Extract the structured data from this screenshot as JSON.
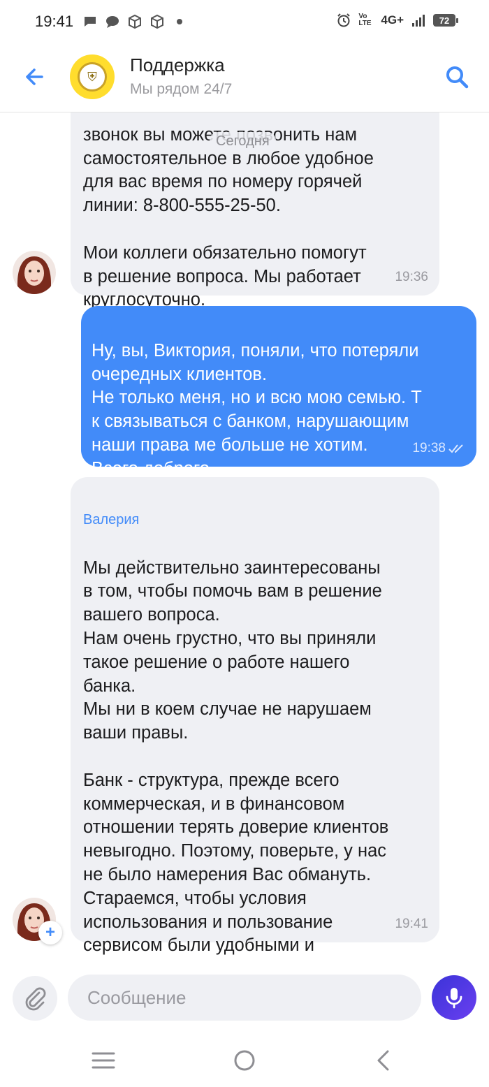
{
  "status_bar": {
    "time": "19:41",
    "network": "4G+",
    "volte": "Vo LTE",
    "battery": "72",
    "left_icons": [
      "chat-icon",
      "chat-bubble-icon",
      "cube-icon",
      "cube-icon",
      "dot-icon"
    ],
    "right_icons": [
      "alarm-icon",
      "volte-icon",
      "signal-icon",
      "battery-icon"
    ]
  },
  "header": {
    "title": "Поддержка",
    "subtitle": "Мы рядом 24/7",
    "back_icon": "arrow-left-icon",
    "search_icon": "search-icon",
    "avatar": "tinkoff-logo"
  },
  "date_divider": "Сегодня",
  "messages": [
    {
      "direction": "incoming",
      "text": "звонок вы можете позвонить нам\nсамостоятельное в любое удобное\nдля вас время по номеру горячей\nлинии: 8-800-555-25-50.\n\nМои коллеги обязательно помогут\nв решение вопроса. Мы работает\nкруглосуточно.",
      "time": "19:36"
    },
    {
      "direction": "outgoing",
      "text": "Ну, вы, Виктория, поняли, что потеряли\nочередных клиентов.\nНе только меня, но и всю мою семью. Т\nк связываться с банком, нарушающим\nнаши права ме больше не хотим.\nВсего доброго",
      "time": "19:38",
      "status": "read"
    },
    {
      "direction": "incoming",
      "sender": "Валерия",
      "text": "Мы действительно заинтересованы\nв том, чтобы помочь вам в решение\nвашего вопроса.\nНам очень грустно, что вы приняли\nтакое решение о работе нашего\nбанка.\nМы ни в коем случае не нарушаем\nваши правы.\n\nБанк - структура, прежде всего\nкоммерческая, и в финансовом\nотношении терять доверие клиентов\nневыгодно. Поэтому, поверьте, у нас\nне было намерения Вас обмануть.\nСтараемся, чтобы условия\nиспользования и пользование\nсервисом были удобными и\nпрозрачными.",
      "time": "19:41"
    }
  ],
  "composer": {
    "placeholder": "Сообщение",
    "value": "",
    "attach_icon": "paperclip-icon",
    "mic_icon": "microphone-icon"
  },
  "colors": {
    "accent": "#428bf9",
    "incoming_bubble": "#eff0f4",
    "outgoing_bubble": "#428bf9",
    "mic_button": "#4a36e0",
    "bank_yellow": "#ffdd2d"
  }
}
